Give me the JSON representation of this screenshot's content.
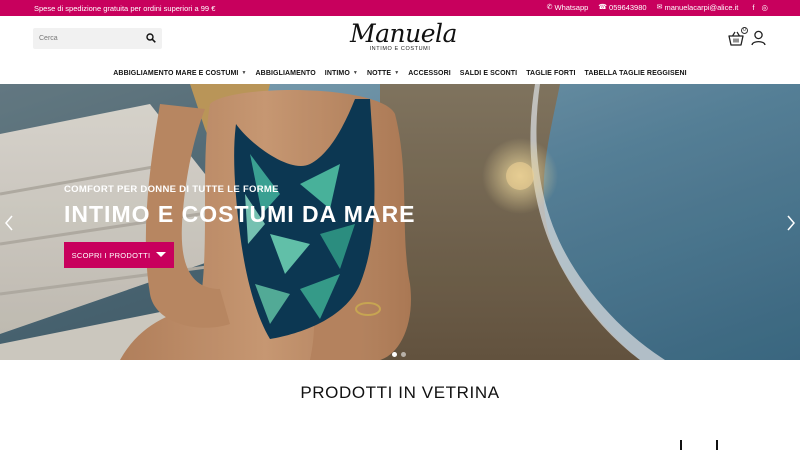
{
  "topbar": {
    "promo": "Spese di spedizione gratuita per ordini superiori a 99 €",
    "whatsapp": "Whatsapp",
    "phone": "059643980",
    "email": "manuelacarpi@alice.it",
    "social": [
      "f",
      "◎"
    ],
    "bg_color": "#c8005d"
  },
  "header": {
    "search_placeholder": "Cerca",
    "logo_script": "Manuela",
    "logo_tagline": "INTIMO E COSTUMI",
    "cart_count": "0"
  },
  "nav": {
    "items": [
      {
        "label": "ABBIGLIAMENTO MARE E COSTUMI",
        "caret": true
      },
      {
        "label": "ABBIGLIAMENTO",
        "caret": false
      },
      {
        "label": "INTIMO",
        "caret": true
      },
      {
        "label": "NOTTE",
        "caret": true
      },
      {
        "label": "ACCESSORI",
        "caret": false
      },
      {
        "label": "SALDI E SCONTI",
        "caret": false
      },
      {
        "label": "TAGLIE FORTI",
        "caret": false
      },
      {
        "label": "TABELLA TAGLIE REGGISENI",
        "caret": false
      }
    ]
  },
  "hero": {
    "kicker": "COMFORT PER DONNE DI TUTTE LE FORME",
    "title": "INTIMO E COSTUMI DA MARE",
    "cta_label": "SCOPRI I PRODOTTI",
    "active_slide": 1,
    "slides": 2
  },
  "section": {
    "title": "PRODOTTI IN VETRINA"
  }
}
